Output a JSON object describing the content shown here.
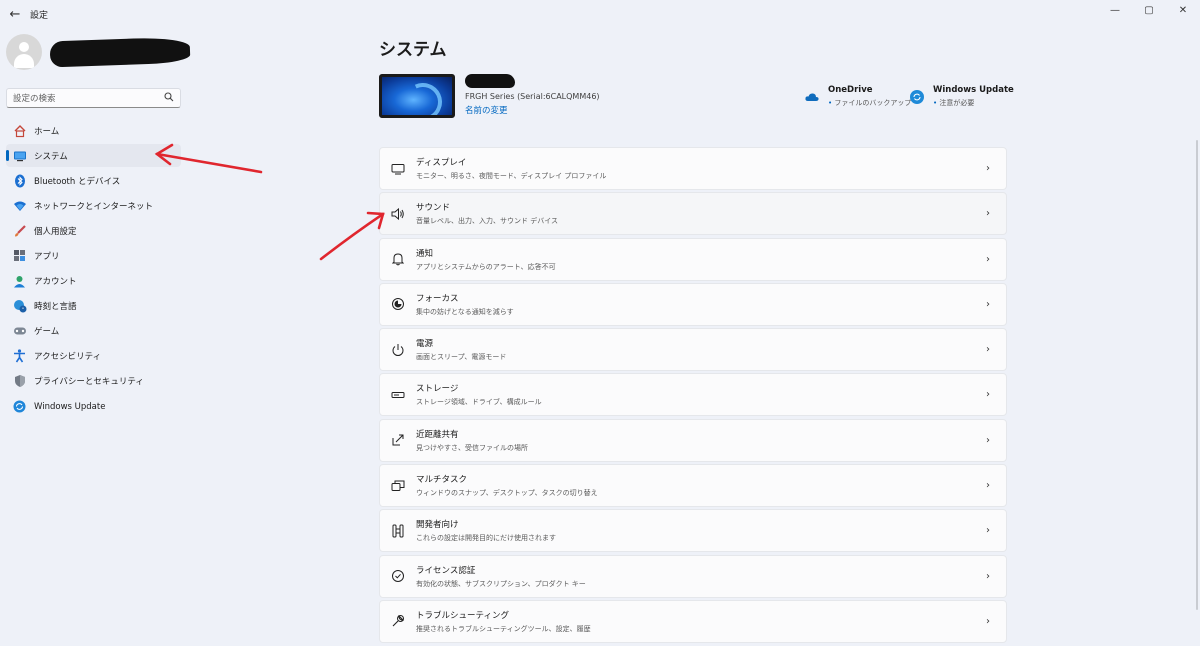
{
  "window": {
    "title": "設定",
    "back_icon": "arrow-left-icon",
    "minimize_glyph": "—",
    "maximize_glyph": "▢",
    "close_glyph": "✕"
  },
  "search": {
    "placeholder": "設定の検索"
  },
  "sidebar": {
    "items": [
      {
        "label": "ホーム",
        "icon": "home-icon"
      },
      {
        "label": "システム",
        "icon": "monitor-icon",
        "selected": true
      },
      {
        "label": "Bluetooth とデバイス",
        "icon": "bluetooth-icon"
      },
      {
        "label": "ネットワークとインターネット",
        "icon": "wifi-icon"
      },
      {
        "label": "個人用設定",
        "icon": "paintbrush-icon"
      },
      {
        "label": "アプリ",
        "icon": "apps-icon"
      },
      {
        "label": "アカウント",
        "icon": "account-icon"
      },
      {
        "label": "時刻と言語",
        "icon": "globe-clock-icon"
      },
      {
        "label": "ゲーム",
        "icon": "gamepad-icon"
      },
      {
        "label": "アクセシビリティ",
        "icon": "accessibility-icon"
      },
      {
        "label": "プライバシーとセキュリティ",
        "icon": "shield-icon"
      },
      {
        "label": "Windows Update",
        "icon": "update-icon"
      }
    ]
  },
  "main": {
    "title": "システム",
    "device": {
      "model": "FRGH Series (Serial:6CALQMM46)",
      "rename": "名前の変更"
    },
    "quick_links": [
      {
        "title": "OneDrive",
        "sub": "ファイルのバックアップ",
        "icon": "onedrive-icon",
        "color": "#0f6cbd"
      },
      {
        "title": "Windows Update",
        "sub": "注意が必要",
        "icon": "update-icon",
        "color": "#1f8ad8"
      }
    ],
    "settings": [
      {
        "title": "ディスプレイ",
        "sub": "モニター、明るさ、夜間モード、ディスプレイ プロファイル",
        "icon": "display-icon"
      },
      {
        "title": "サウンド",
        "sub": "音量レベル、出力、入力、サウンド デバイス",
        "icon": "speaker-icon"
      },
      {
        "title": "通知",
        "sub": "アプリとシステムからのアラート、応答不可",
        "icon": "bell-icon"
      },
      {
        "title": "フォーカス",
        "sub": "集中の妨げとなる通知を減らす",
        "icon": "focus-icon"
      },
      {
        "title": "電源",
        "sub": "画面とスリープ、電源モード",
        "icon": "power-icon"
      },
      {
        "title": "ストレージ",
        "sub": "ストレージ領域、ドライブ、構成ルール",
        "icon": "storage-icon"
      },
      {
        "title": "近距離共有",
        "sub": "見つけやすさ、受信ファイルの場所",
        "icon": "share-icon"
      },
      {
        "title": "マルチタスク",
        "sub": "ウィンドウのスナップ、デスクトップ、タスクの切り替え",
        "icon": "multitask-icon"
      },
      {
        "title": "開発者向け",
        "sub": "これらの設定は開発目的にだけ使用されます",
        "icon": "developer-icon"
      },
      {
        "title": "ライセンス認証",
        "sub": "有効化の状態、サブスクリプション、プロダクト キー",
        "icon": "check-circle-icon"
      },
      {
        "title": "トラブルシューティング",
        "sub": "推奨されるトラブルシューティングツール、設定、履歴",
        "icon": "wrench-icon"
      }
    ]
  },
  "colors": {
    "accent": "#0067c0",
    "annotation": "#e0262e"
  }
}
